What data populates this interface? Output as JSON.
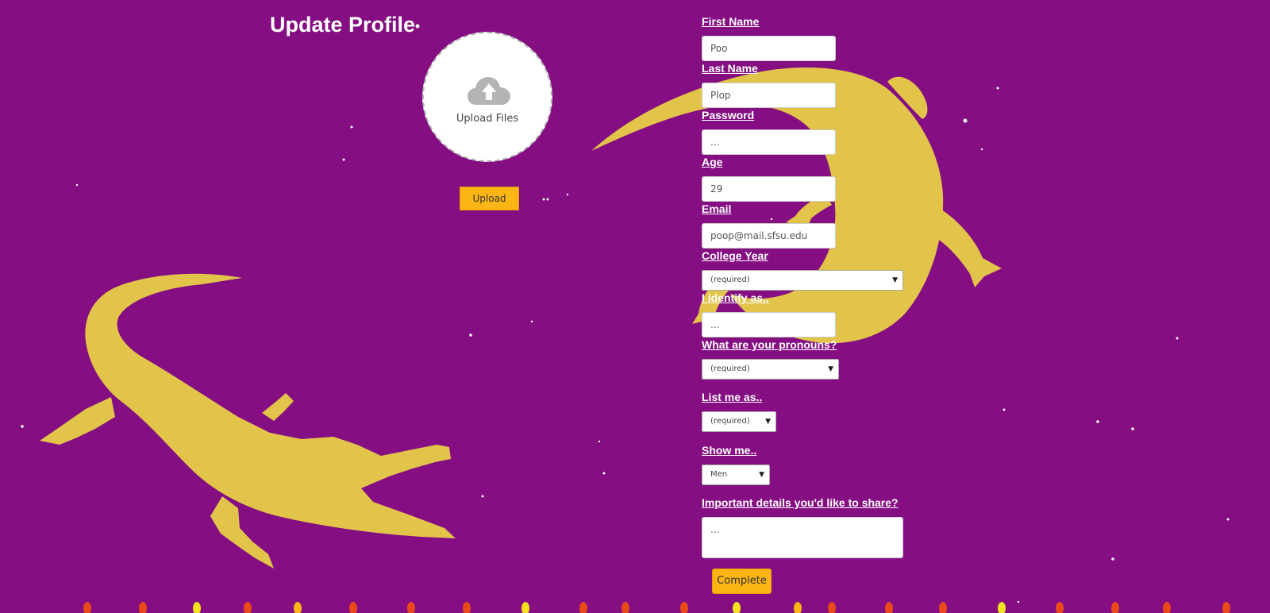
{
  "page": {
    "title": "Update Profile"
  },
  "upload": {
    "dropzone_label": "Upload Files",
    "button_label": "Upload"
  },
  "form": {
    "first_name": {
      "label": "First Name",
      "value": "Poo"
    },
    "last_name": {
      "label": "Last Name",
      "value": "Plop"
    },
    "password": {
      "label": "Password",
      "value": "..."
    },
    "age": {
      "label": "Age",
      "value": "29"
    },
    "email": {
      "label": "Email",
      "value": "poop@mail.sfsu.edu"
    },
    "college_year": {
      "label": "College Year",
      "selected": "(required)"
    },
    "identify": {
      "label": "I identify as..",
      "value": "..."
    },
    "pronouns": {
      "label": "What are your pronouns?",
      "selected": "(required)"
    },
    "list_me": {
      "label": "List me as..",
      "selected": "(required)"
    },
    "show_me": {
      "label": "Show me..",
      "selected": "Men"
    },
    "details": {
      "label": "Important details you'd like to share?",
      "value": "..."
    },
    "complete_label": "Complete"
  },
  "colors": {
    "background": "#840e82",
    "accent": "#fbb514",
    "alligator": "#e2c44b"
  }
}
